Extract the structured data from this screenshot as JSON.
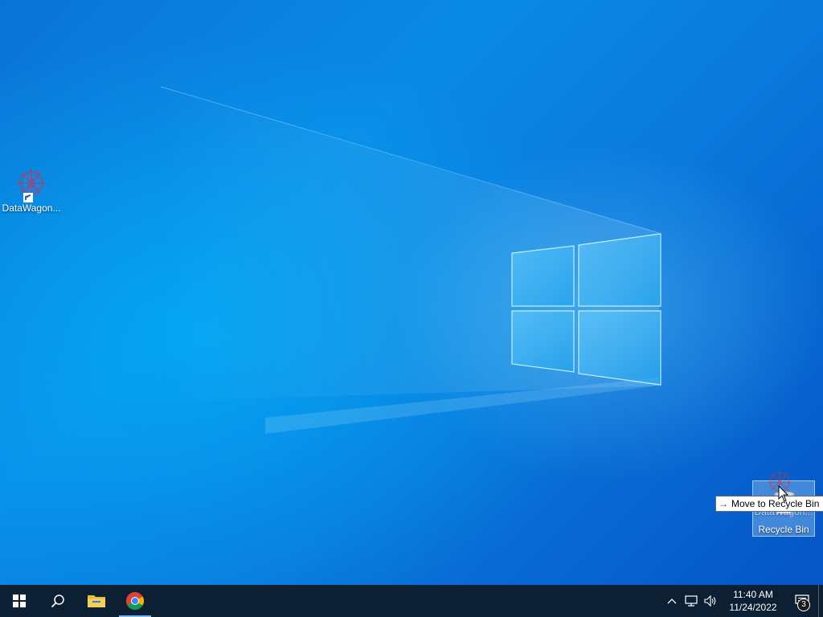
{
  "desktop": {
    "icons": [
      {
        "label": "DataWagon...",
        "icon": "datawagon-app-icon",
        "shortcut": true
      },
      {
        "label": "Recycle Bin",
        "icon": "recycle-bin-icon",
        "selected": true
      }
    ],
    "drag_ghost": {
      "label": "DataWagon...",
      "icon": "datawagon-app-icon"
    },
    "tooltip": {
      "arrow": "→",
      "text": "Move to Recycle Bin"
    },
    "colors": {
      "wallpaper": "#0a8ae6",
      "accent": "#7ab6ef"
    }
  },
  "taskbar": {
    "buttons": [
      {
        "name": "start",
        "icon": "windows-logo-icon"
      },
      {
        "name": "search",
        "icon": "search-icon"
      },
      {
        "name": "file-explorer",
        "icon": "folder-icon"
      },
      {
        "name": "chrome",
        "icon": "chrome-icon",
        "active": true
      }
    ],
    "tray": {
      "icons": [
        "chevron-up-icon",
        "network-icon",
        "volume-icon"
      ],
      "time": "11:40 AM",
      "date": "11/24/2022",
      "notification_count": "3"
    },
    "color": "#0d1f33"
  }
}
